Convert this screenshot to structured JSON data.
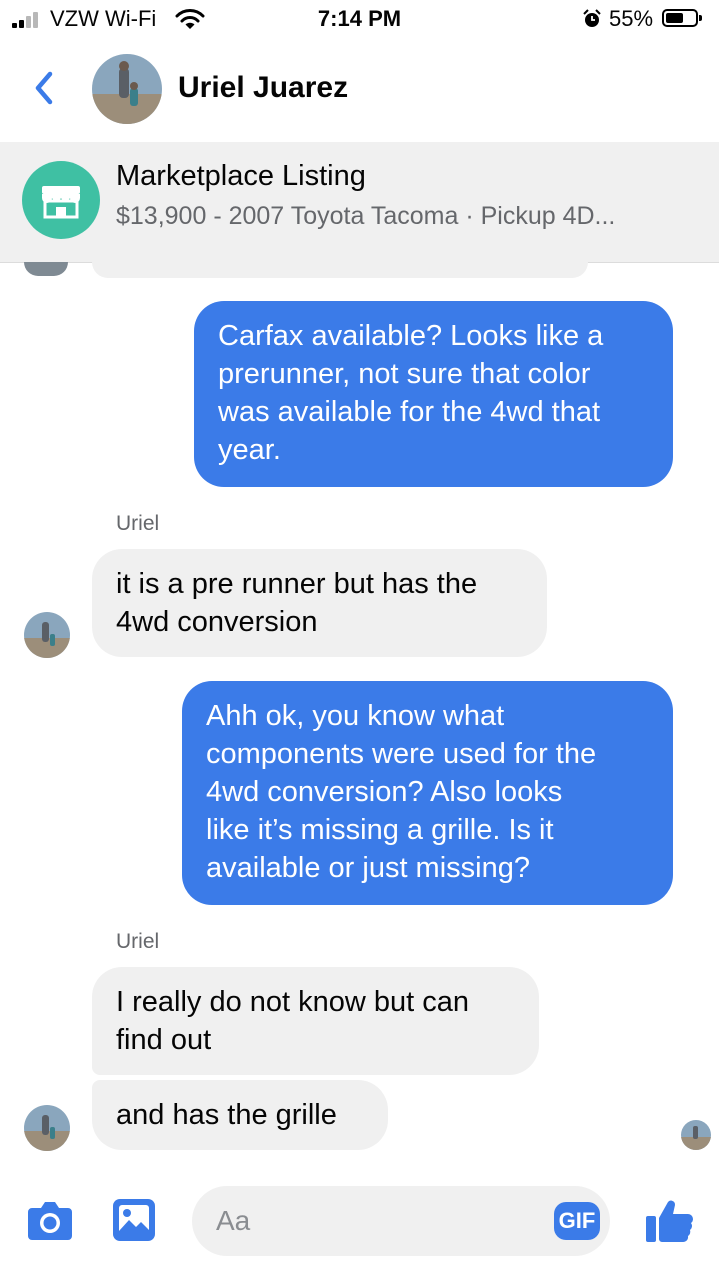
{
  "status_bar": {
    "carrier": "VZW Wi-Fi",
    "time": "7:14 PM",
    "battery_percent": "55%"
  },
  "header": {
    "contact_name": "Uriel Juarez"
  },
  "listing": {
    "title": "Marketplace Listing",
    "subtitle": "$13,900 - 2007 Toyota Tacoma · Pickup 4D..."
  },
  "messages": [
    {
      "direction": "outgoing",
      "lines": [
        "Carfax available? Looks like a",
        "prerunner, not sure that color",
        "was available for the 4wd that",
        "year."
      ]
    },
    {
      "direction": "incoming",
      "sender": "Uriel",
      "lines": [
        "it is a pre runner but has the",
        "4wd conversion"
      ]
    },
    {
      "direction": "outgoing",
      "lines": [
        "Ahh ok, you know what",
        "components were used for the",
        "4wd conversion? Also looks",
        "like it’s missing a grille. Is it",
        "available or just missing?"
      ]
    },
    {
      "direction": "incoming",
      "sender": "Uriel",
      "lines": [
        "I really do not know but can",
        "find out"
      ]
    },
    {
      "direction": "incoming",
      "lines": [
        "and has the grille"
      ]
    }
  ],
  "composer": {
    "placeholder": "Aa",
    "gif_label": "GIF"
  },
  "colors": {
    "accent": "#3b7be8",
    "incoming_bubble": "#f0f0f0",
    "listing_icon": "#3fc0a3"
  },
  "icons": [
    "chevron-left-icon",
    "camera-icon",
    "image-icon",
    "gif-icon",
    "thumbs-up-icon",
    "wifi-icon",
    "alarm-icon",
    "battery-icon",
    "storefront-icon"
  ]
}
